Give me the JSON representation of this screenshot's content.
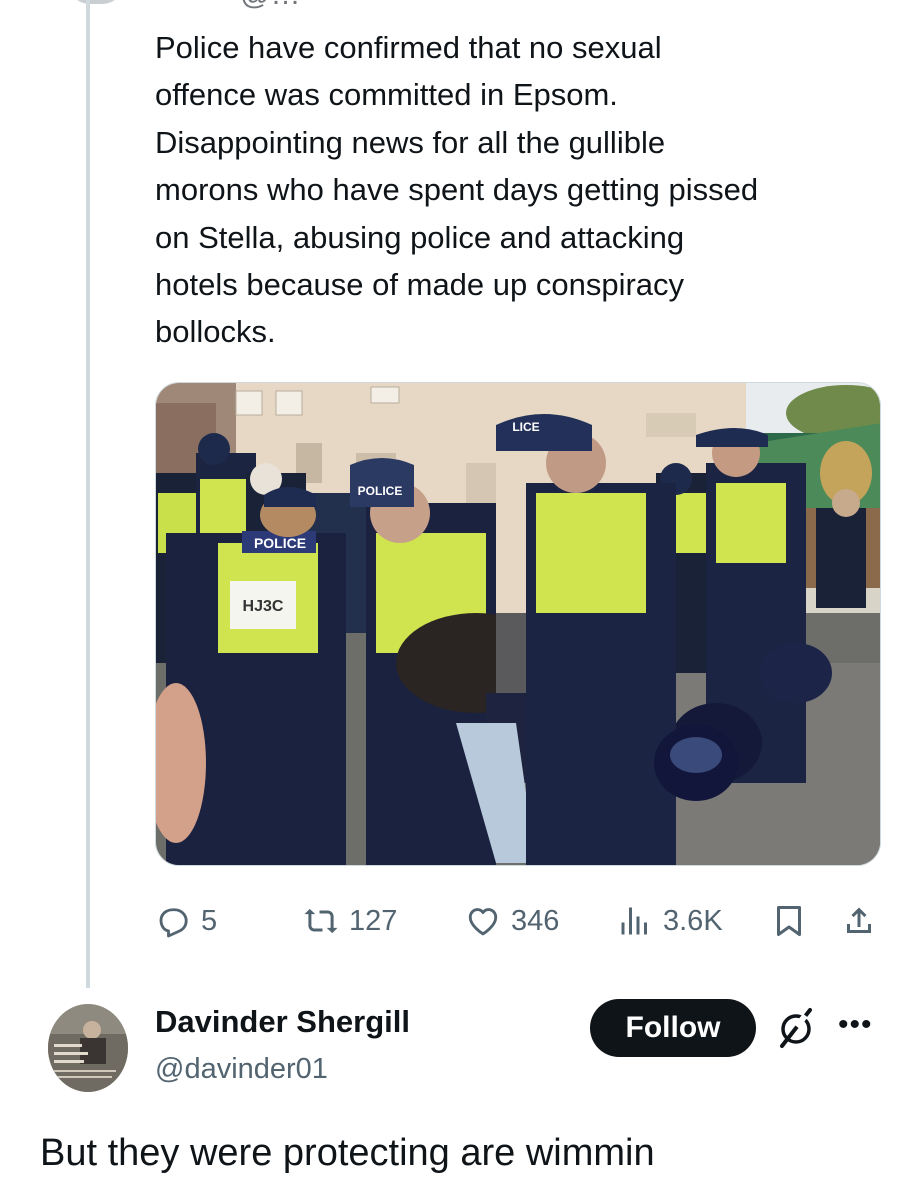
{
  "parent_tweet": {
    "author_handle_partial": "@…",
    "text_lines": [
      "Police have confirmed that no sexual",
      "offence was committed in Epsom.",
      "Disappointing news for all the gullible",
      "morons who have spent days getting pissed",
      "on Stella, abusing police and attacking",
      "hotels because of made up conspiracy",
      "bollocks."
    ],
    "photo": {
      "icon": "photo-police-arrest",
      "vest_text": "POLICE",
      "shoulder_number": "HJ3C",
      "cap_text_1": "POLICE",
      "cap_text_2": "LICE"
    },
    "actions": {
      "replies": "5",
      "reposts": "127",
      "likes": "346",
      "views": "3.6K"
    }
  },
  "reply_tweet": {
    "author_name": "Davinder Shergill",
    "author_handle": "@davinder01",
    "follow_label": "Follow",
    "more_label": "•••",
    "text": "But they were protecting are wimmin"
  },
  "colors": {
    "text": "#0f1419",
    "secondary": "#536471",
    "thread_line": "#cfd9de",
    "follow_bg": "#0f1419"
  }
}
